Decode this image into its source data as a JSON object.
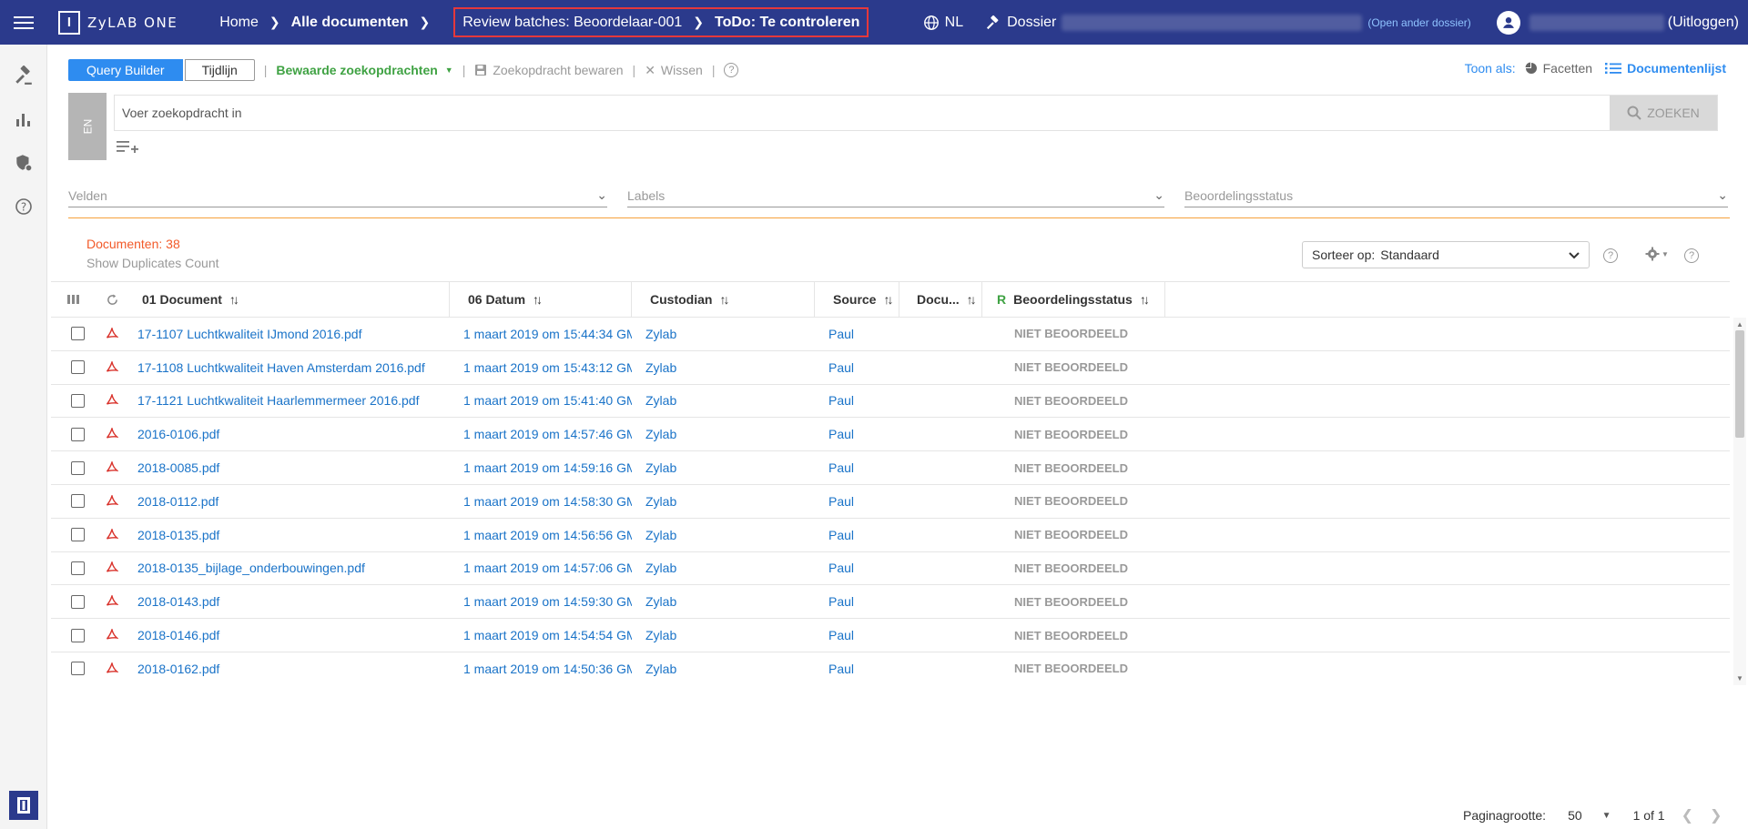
{
  "app": {
    "brand": "ZyLAB ONE",
    "logo_letter": "I"
  },
  "breadcrumb": {
    "home": "Home",
    "all_docs": "Alle documenten",
    "review_batch": "Review batches: Beoordelaar-001",
    "todo": "ToDo: Te controleren"
  },
  "topbar": {
    "language": "NL",
    "dossier_label": "Dossier",
    "open_other": "(Open ander dossier)",
    "logout": "(Uitloggen)"
  },
  "toolbar": {
    "query_builder": "Query Builder",
    "timeline": "Tijdlijn",
    "saved_searches": "Bewaarde zoekopdrachten",
    "save_search": "Zoekopdracht bewaren",
    "clear": "Wissen",
    "help": "?"
  },
  "view_as": {
    "label": "Toon als:",
    "facets": "Facetten",
    "doclist": "Documentenlijst"
  },
  "search": {
    "lang_tab": "EN",
    "placeholder": "Voer zoekopdracht in",
    "button": "ZOEKEN"
  },
  "filters": {
    "fields": "Velden",
    "labels": "Labels",
    "review_status": "Beoordelingsstatus"
  },
  "results": {
    "count_label": "Documenten: 38",
    "show_dupes": "Show Duplicates Count",
    "sort_label": "Sorteer op:",
    "sort_value": "Standaard"
  },
  "table": {
    "headers": {
      "document": "01 Document",
      "date": "06 Datum",
      "custodian": "Custodian",
      "source": "Source",
      "docu": "Docu...",
      "status_letter": "R",
      "status": "Beoordelingsstatus"
    },
    "rows": [
      {
        "doc": "17-1107 Luchtkwaliteit IJmond 2016.pdf",
        "date": "1 maart 2019 om 15:44:34 GM...",
        "custodian": "Zylab",
        "source": "Paul",
        "status": "NIET BEOORDEELD"
      },
      {
        "doc": "17-1108 Luchtkwaliteit Haven Amsterdam 2016.pdf",
        "date": "1 maart 2019 om 15:43:12 GM...",
        "custodian": "Zylab",
        "source": "Paul",
        "status": "NIET BEOORDEELD"
      },
      {
        "doc": "17-1121 Luchtkwaliteit Haarlemmermeer 2016.pdf",
        "date": "1 maart 2019 om 15:41:40 GM...",
        "custodian": "Zylab",
        "source": "Paul",
        "status": "NIET BEOORDEELD"
      },
      {
        "doc": "2016-0106.pdf",
        "date": "1 maart 2019 om 14:57:46 GM...",
        "custodian": "Zylab",
        "source": "Paul",
        "status": "NIET BEOORDEELD"
      },
      {
        "doc": "2018-0085.pdf",
        "date": "1 maart 2019 om 14:59:16 GM...",
        "custodian": "Zylab",
        "source": "Paul",
        "status": "NIET BEOORDEELD"
      },
      {
        "doc": "2018-0112.pdf",
        "date": "1 maart 2019 om 14:58:30 GM...",
        "custodian": "Zylab",
        "source": "Paul",
        "status": "NIET BEOORDEELD"
      },
      {
        "doc": "2018-0135.pdf",
        "date": "1 maart 2019 om 14:56:56 GM...",
        "custodian": "Zylab",
        "source": "Paul",
        "status": "NIET BEOORDEELD"
      },
      {
        "doc": "2018-0135_bijlage_onderbouwingen.pdf",
        "date": "1 maart 2019 om 14:57:06 GM...",
        "custodian": "Zylab",
        "source": "Paul",
        "status": "NIET BEOORDEELD"
      },
      {
        "doc": "2018-0143.pdf",
        "date": "1 maart 2019 om 14:59:30 GM...",
        "custodian": "Zylab",
        "source": "Paul",
        "status": "NIET BEOORDEELD"
      },
      {
        "doc": "2018-0146.pdf",
        "date": "1 maart 2019 om 14:54:54 GM...",
        "custodian": "Zylab",
        "source": "Paul",
        "status": "NIET BEOORDEELD"
      },
      {
        "doc": "2018-0162.pdf",
        "date": "1 maart 2019 om 14:50:36 GM...",
        "custodian": "Zylab",
        "source": "Paul",
        "status": "NIET BEOORDEELD"
      }
    ]
  },
  "footer": {
    "page_size_label": "Paginagrootte:",
    "page_size": "50",
    "pages": "1 of 1"
  },
  "colors": {
    "topbar": "#2b3a8c",
    "primary": "#2e8cf0",
    "link": "#1a73c8",
    "green": "#3fa243",
    "orange": "#f25a29",
    "highlight_border": "#e5383b",
    "pdf_red": "#d9322b"
  }
}
